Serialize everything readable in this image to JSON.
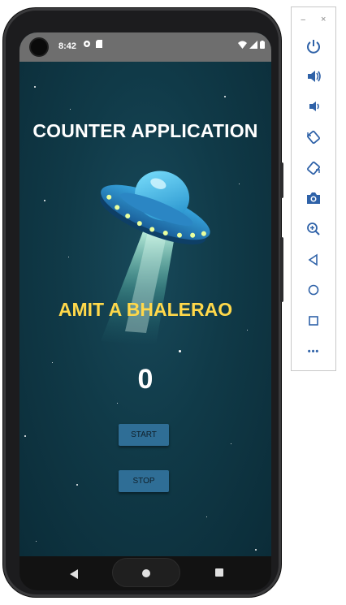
{
  "status_bar": {
    "time": "8:42"
  },
  "app": {
    "title": "COUNTER APPLICATION",
    "author": "AMIT A BHALERAO",
    "counter": "0",
    "start_label": "START",
    "stop_label": "STOP"
  },
  "emulator_toolbar": {
    "minimize_glyph": "−",
    "close_glyph": "×",
    "buttons": [
      "power-icon",
      "volume-up-icon",
      "volume-down-icon",
      "rotate-left-icon",
      "rotate-right-icon",
      "camera-icon",
      "zoom-icon",
      "back-icon",
      "home-icon",
      "overview-icon",
      "more-icon"
    ],
    "more_glyph": "•••"
  },
  "colors": {
    "app_background": "#103a48",
    "title_text": "#ffffff",
    "author_text": "#ffd84a",
    "button_background": "#2f6e96",
    "toolbar_icon": "#2f62a8"
  }
}
